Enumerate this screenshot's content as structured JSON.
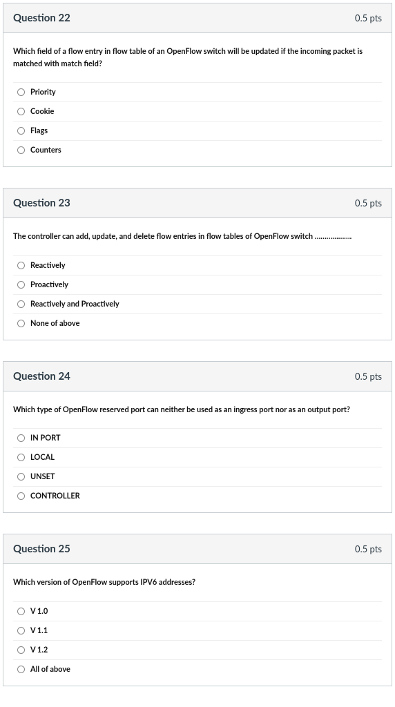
{
  "questions": [
    {
      "title": "Question 22",
      "points": "0.5 pts",
      "prompt": "Which field of a flow entry in flow table of an OpenFlow switch will be updated if the incoming packet is matched with match field?",
      "options": [
        "Priority",
        "Cookie",
        "Flags",
        "Counters"
      ]
    },
    {
      "title": "Question 23",
      "points": "0.5 pts",
      "prompt": "The controller can add, update, and delete flow entries in flow tables of OpenFlow switch ……………….",
      "options": [
        "Reactively",
        "Proactively",
        "Reactively and Proactively",
        "None of above"
      ]
    },
    {
      "title": "Question 24",
      "points": "0.5 pts",
      "prompt": "Which type of OpenFlow reserved port can neither be used as an ingress port nor as an output port?",
      "options": [
        "IN PORT",
        "LOCAL",
        "UNSET",
        "CONTROLLER"
      ]
    },
    {
      "title": "Question 25",
      "points": "0.5 pts",
      "prompt": "Which version of OpenFlow supports IPV6 addresses?",
      "options": [
        "V 1.0",
        "V 1.1",
        "V 1.2",
        "All of above"
      ]
    }
  ]
}
